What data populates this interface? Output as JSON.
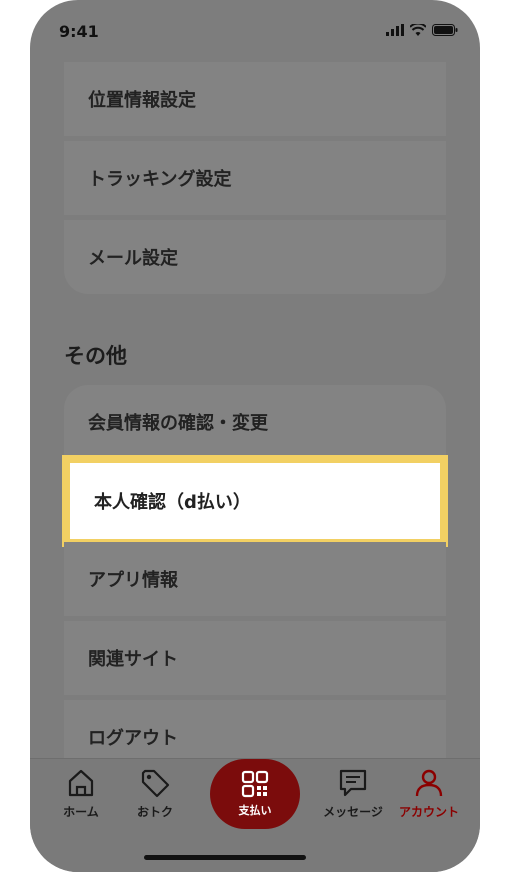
{
  "status_bar": {
    "time": "9:41"
  },
  "settings_group": {
    "items": [
      {
        "label": "位置情報設定"
      },
      {
        "label": "トラッキング設定"
      },
      {
        "label": "メール設定"
      }
    ]
  },
  "other_section": {
    "title": "その他",
    "items": [
      {
        "label": "会員情報の確認・変更"
      },
      {
        "label": "本人確認（d払い）"
      },
      {
        "label": "アプリ情報"
      },
      {
        "label": "関連サイト"
      },
      {
        "label": "ログアウト"
      }
    ]
  },
  "tab_bar": {
    "home": "ホーム",
    "deals": "おトク",
    "pay": "支払い",
    "messages": "メッセージ",
    "account": "アカウント",
    "active_color": "#8b0000"
  }
}
